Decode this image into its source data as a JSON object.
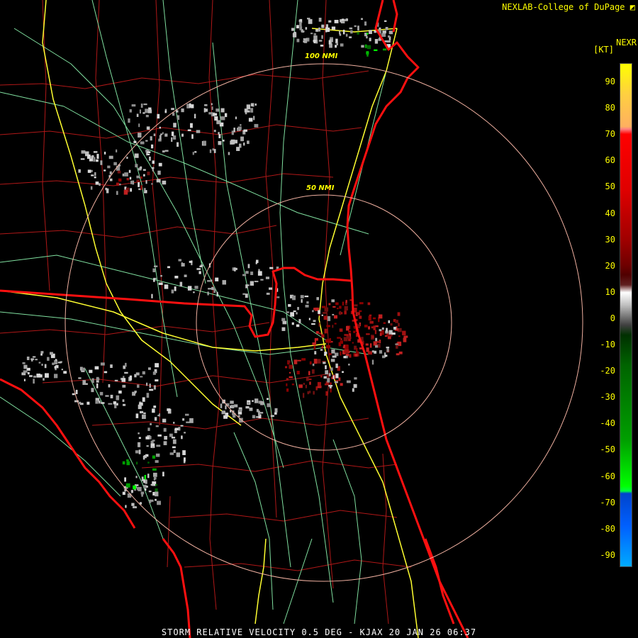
{
  "header": {
    "brand": "NEXLAB-College of DuPage",
    "product": "NEXR",
    "unit": "[KT]"
  },
  "footer": {
    "caption": "STORM RELATIVE VELOCITY 0.5 DEG - KJAX 20 JAN 26 06:37"
  },
  "range_rings": [
    {
      "label": "100 NMI"
    },
    {
      "label": "50 NMI"
    }
  ],
  "colorbar": {
    "ticks": [
      "90",
      "80",
      "70",
      "60",
      "50",
      "40",
      "30",
      "20",
      "10",
      "0",
      "-10",
      "-20",
      "-30",
      "-40",
      "-50",
      "-60",
      "-70",
      "-80",
      "-90"
    ],
    "colors": [
      "#ffff00",
      "#ffb060",
      "#ff0000",
      "#8b0000",
      "#ffffff",
      "#808080",
      "#006400",
      "#00ff00",
      "#0044ff",
      "#00aaff"
    ]
  },
  "map_colors": {
    "state_border": "#ff1010",
    "county_border": "#b01818",
    "interstate": "#ffff30",
    "highway": "#80e0a0",
    "ring": "#f0b0a0"
  }
}
